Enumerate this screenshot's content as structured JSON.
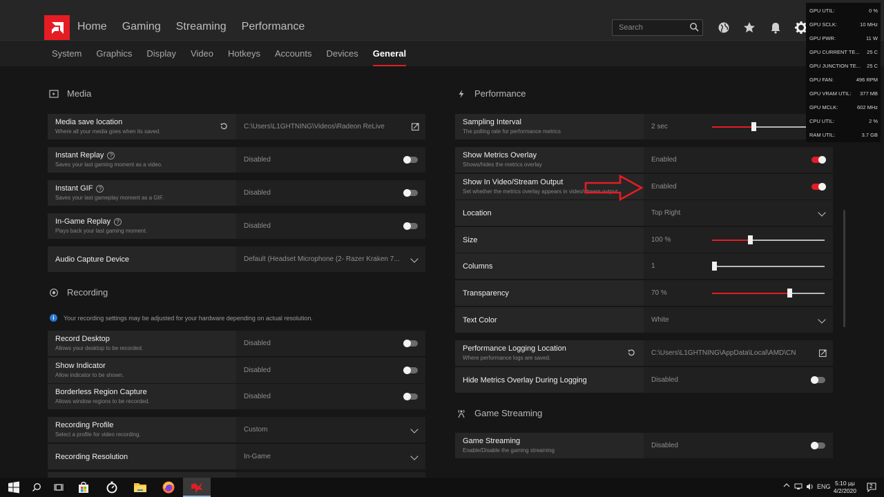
{
  "header": {
    "nav": [
      "Home",
      "Gaming",
      "Streaming",
      "Performance"
    ],
    "search_placeholder": "Search"
  },
  "subnav": {
    "items": [
      "System",
      "Graphics",
      "Display",
      "Video",
      "Hotkeys",
      "Accounts",
      "Devices",
      "General"
    ],
    "active": "General"
  },
  "media": {
    "title": "Media",
    "save_location": {
      "label": "Media save location",
      "sub": "Where all your media goes when its saved.",
      "value": "C:\\Users\\L1GHTNING\\Videos\\Radeon ReLive"
    },
    "instant_replay": {
      "label": "Instant Replay",
      "sub": "Saves your last gaming moment as a video.",
      "value": "Disabled"
    },
    "instant_gif": {
      "label": "Instant GIF",
      "sub": "Saves your last gameplay moment as a GIF.",
      "value": "Disabled"
    },
    "ingame_replay": {
      "label": "In-Game Replay",
      "sub": "Plays back your last gaming moment.",
      "value": "Disabled"
    },
    "audio_capture": {
      "label": "Audio Capture Device",
      "value": "Default (Headset Microphone (2- Razer Kraken 7..."
    }
  },
  "recording": {
    "title": "Recording",
    "info": "Your recording settings may be adjusted for your hardware depending on actual resolution.",
    "record_desktop": {
      "label": "Record Desktop",
      "sub": "Allows your desktop to be recorded.",
      "value": "Disabled"
    },
    "show_indicator": {
      "label": "Show Indicator",
      "sub": "Allow indicator to be shown.",
      "value": "Disabled"
    },
    "borderless": {
      "label": "Borderless Region Capture",
      "sub": "Allows window regions to be recorded.",
      "value": "Disabled"
    },
    "profile": {
      "label": "Recording Profile",
      "sub": "Select a profile for video recording.",
      "value": "Custom"
    },
    "resolution": {
      "label": "Recording Resolution",
      "value": "In-Game"
    }
  },
  "performance": {
    "title": "Performance",
    "sampling": {
      "label": "Sampling Interval",
      "sub": "The polling rate for performance metrics",
      "value": "2 sec",
      "level": 0.37
    },
    "show_overlay": {
      "label": "Show Metrics Overlay",
      "sub": "Shows/hides the metrics overlay",
      "value": "Enabled"
    },
    "show_in_video": {
      "label": "Show In Video/Stream Output",
      "sub": "Set whether the metrics overlay appears in video/stream output",
      "value": "Enabled"
    },
    "location": {
      "label": "Location",
      "value": "Top Right"
    },
    "size": {
      "label": "Size",
      "value": "100 %",
      "level": 0.34
    },
    "columns": {
      "label": "Columns",
      "value": "1",
      "level": 0.02
    },
    "transparency": {
      "label": "Transparency",
      "value": "70 %",
      "level": 0.69
    },
    "text_color": {
      "label": "Text Color",
      "value": "White"
    },
    "log_location": {
      "label": "Performance Logging Location",
      "sub": "Where performance logs are saved.",
      "value": "C:\\Users\\L1GHTNING\\AppData\\Local\\AMD\\CN"
    },
    "hide_logging": {
      "label": "Hide Metrics Overlay During Logging",
      "value": "Disabled"
    }
  },
  "game_streaming": {
    "title": "Game Streaming",
    "row": {
      "label": "Game Streaming",
      "sub": "Enable/Disable the gaming streaming",
      "value": "Disabled"
    }
  },
  "metrics_overlay": [
    {
      "k": "GPU UTIL:",
      "v": "0 %"
    },
    {
      "k": "GPU SCLK:",
      "v": "10 MHz"
    },
    {
      "k": "GPU PWR:",
      "v": "11 W"
    },
    {
      "k": "GPU CURRENT TE...",
      "v": "25 C"
    },
    {
      "k": "GPU JUNCTION TE...",
      "v": "25 C"
    },
    {
      "k": "GPU FAN:",
      "v": "496 RPM"
    },
    {
      "k": "GPU VRAM UTIL:",
      "v": "377 MB"
    },
    {
      "k": "GPU MCLK:",
      "v": "602 MHz"
    },
    {
      "k": "CPU UTIL:",
      "v": "2 %"
    },
    {
      "k": "RAM UTIL:",
      "v": "3.7 GB"
    }
  ],
  "taskbar": {
    "lang": "ENG",
    "time": "5:10 μμ",
    "date": "4/2/2020",
    "notif_count": "2"
  },
  "colors": {
    "accent": "#e51c24",
    "panel": "#262626",
    "bg": "#161616"
  }
}
